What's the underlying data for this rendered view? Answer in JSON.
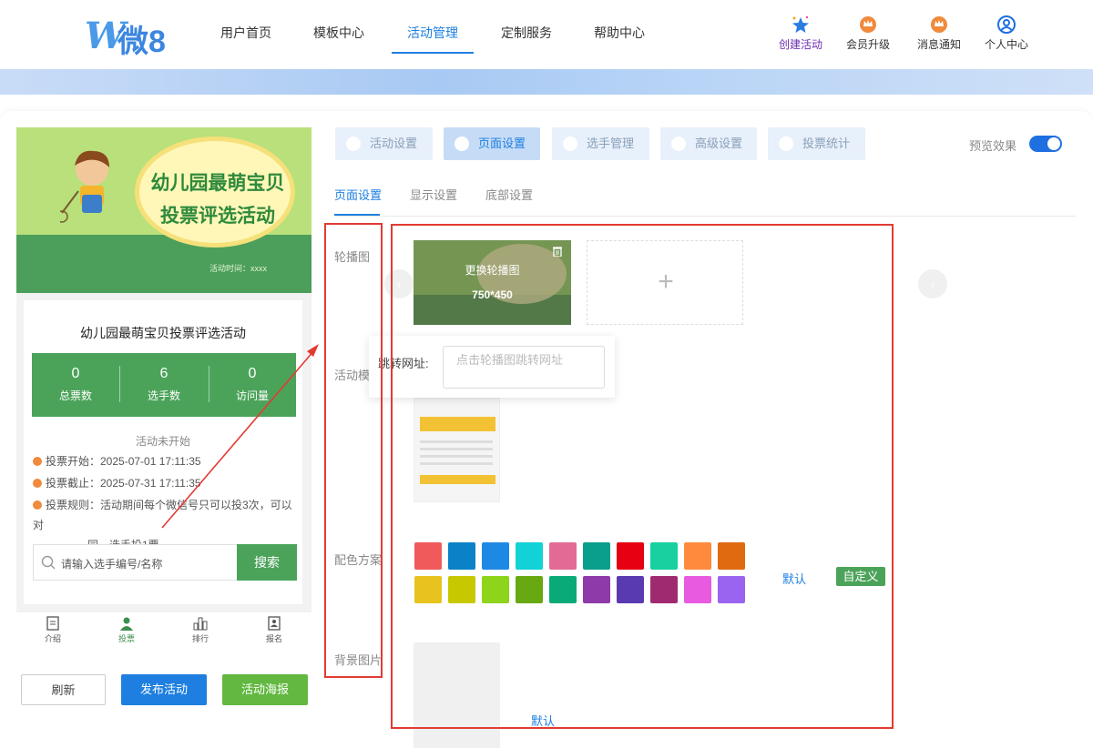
{
  "logo": {
    "mark": "W",
    "text": "微8"
  },
  "nav": [
    {
      "label": "用户首页"
    },
    {
      "label": "模板中心"
    },
    {
      "label": "活动管理",
      "active": true
    },
    {
      "label": "定制服务"
    },
    {
      "label": "帮助中心"
    }
  ],
  "tools": [
    {
      "label": "创建活动",
      "icon": "star-sparkle-icon"
    },
    {
      "label": "会员升级",
      "icon": "crown-badge-icon"
    },
    {
      "label": "消息通知",
      "icon": "crown-bell-icon"
    },
    {
      "label": "个人中心",
      "icon": "user-circle-icon"
    }
  ],
  "colors": {
    "accent": "#1e7fe0",
    "green": "#4ba35a",
    "red": "#e23b33",
    "tool_purple": "#6b2db0",
    "tool_orange": "#f08a3c"
  },
  "phone": {
    "poster_title_1": "幼儿园最萌宝贝",
    "poster_title_2": "投票评选活动",
    "poster_time": "活动时间：xxxx",
    "title": "幼儿园最萌宝贝投票评选活动",
    "stats": [
      {
        "value": "0",
        "label": "总票数"
      },
      {
        "value": "6",
        "label": "选手数"
      },
      {
        "value": "0",
        "label": "访问量"
      }
    ],
    "status": "活动未开始",
    "vote_start": "投票开始：2025-07-01 17:11:35",
    "vote_end": "投票截止：2025-07-31 17:11:35",
    "vote_rule_1": "投票规则：活动期间每个微信号只可以投3次，可以对",
    "vote_rule_2": "同一选手投1票",
    "search_placeholder": "请输入选手编号/名称",
    "search_button": "搜索",
    "tabs": [
      {
        "label": "介绍"
      },
      {
        "label": "投票",
        "active": true
      },
      {
        "label": "排行"
      },
      {
        "label": "报名"
      }
    ]
  },
  "bottom_buttons": {
    "refresh": "刷新",
    "publish": "发布活动",
    "poster": "活动海报"
  },
  "settings": {
    "tabs": [
      {
        "label": "活动设置"
      },
      {
        "label": "页面设置",
        "active": true
      },
      {
        "label": "选手管理"
      },
      {
        "label": "高级设置"
      },
      {
        "label": "投票统计"
      }
    ],
    "preview_label": "预览效果",
    "preview_on": true,
    "subtabs": [
      {
        "label": "页面设置",
        "active": true
      },
      {
        "label": "显示设置"
      },
      {
        "label": "底部设置"
      }
    ],
    "labels": {
      "carousel": "轮播图",
      "template": "活动模",
      "color": "配色方案",
      "bg": "背景图片"
    },
    "carousel": {
      "replace": "更换轮播图",
      "size": "750*450",
      "add": "+"
    },
    "popup": {
      "label": "跳转网址:",
      "placeholder": "点击轮播图跳转网址"
    },
    "swatches_row1": [
      "#f05a5a",
      "#0a82c8",
      "#1e88e5",
      "#12d2d8",
      "#e46a96",
      "#0a9e8c",
      "#e60012",
      "#18d0a0",
      "#ff8a3d",
      "#e06a10"
    ],
    "swatches_row2": [
      "#e8c21e",
      "#c8c800",
      "#8ed41a",
      "#68a810",
      "#0aaa78",
      "#8e3aa8",
      "#5a3ab0",
      "#a02a70",
      "#e85ae0",
      "#9a64f0"
    ],
    "default_label": "默认",
    "custom_label": "自定义",
    "bg_default": "默认"
  }
}
